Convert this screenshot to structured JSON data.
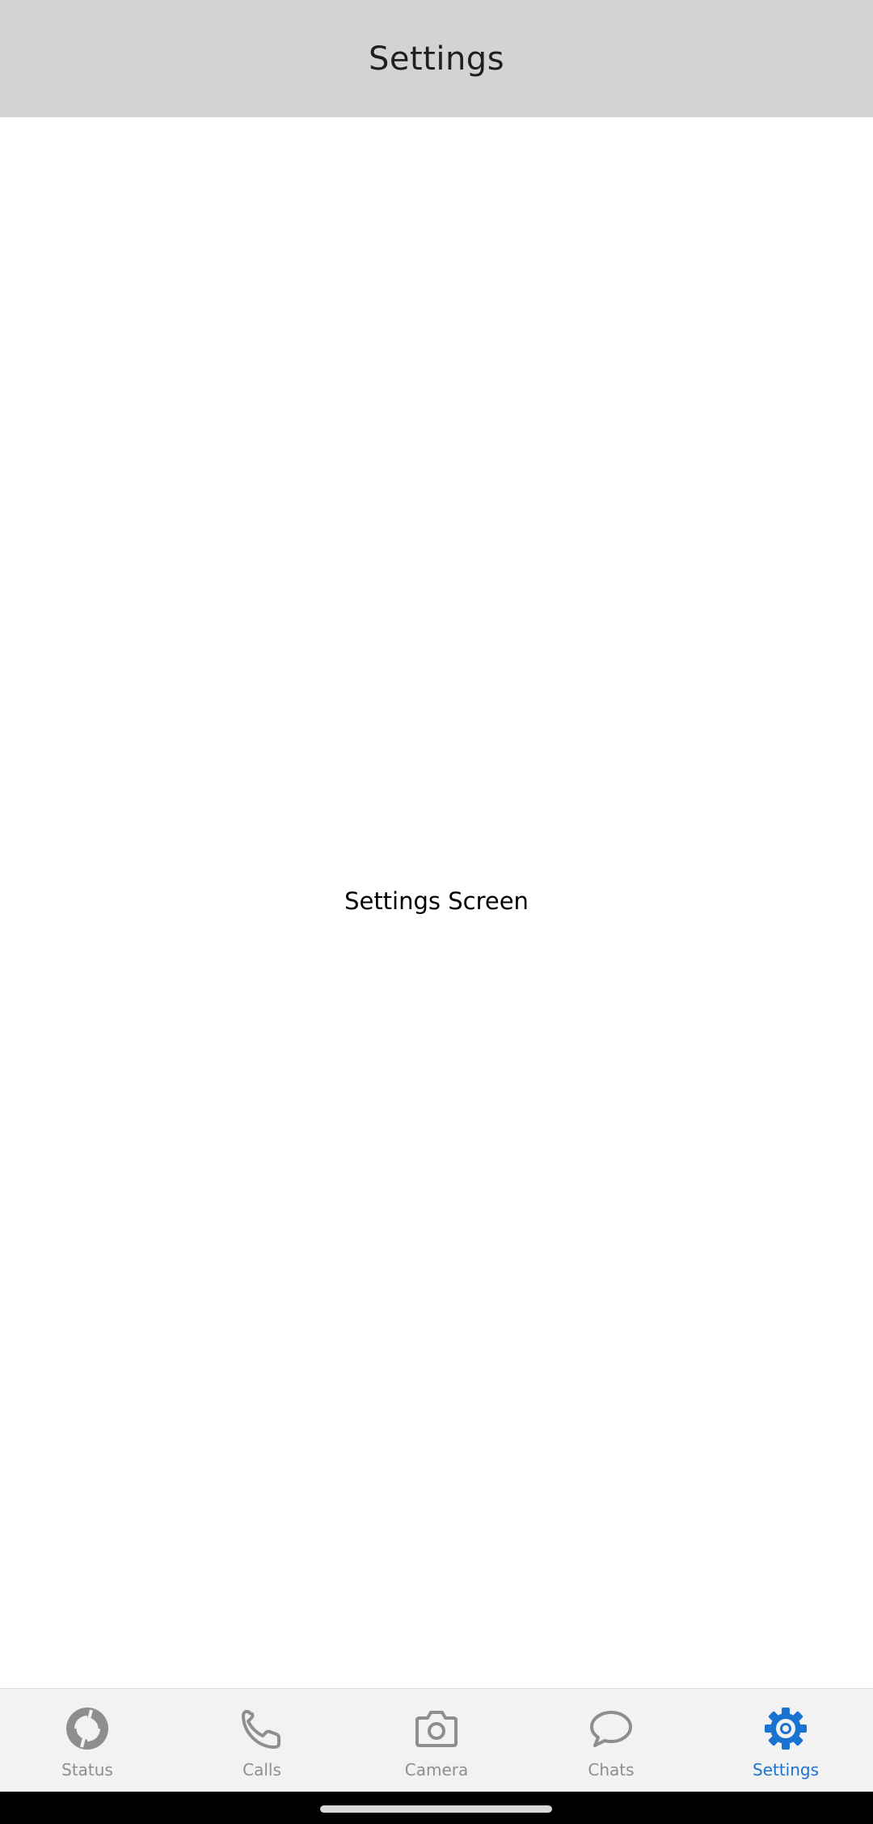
{
  "header": {
    "title": "Settings"
  },
  "main": {
    "text": "Settings Screen"
  },
  "tabs": [
    {
      "label": "Status",
      "icon": "status-icon",
      "active": false
    },
    {
      "label": "Calls",
      "icon": "phone-icon",
      "active": false
    },
    {
      "label": "Camera",
      "icon": "camera-icon",
      "active": false
    },
    {
      "label": "Chats",
      "icon": "chat-bubble-icon",
      "active": false
    },
    {
      "label": "Settings",
      "icon": "gear-icon",
      "active": true
    }
  ],
  "colors": {
    "header_bg": "#d3d3d3",
    "tab_inactive": "#8e8e8e",
    "tab_active": "#1a73d1",
    "tabbar_bg": "#f2f2f2"
  }
}
